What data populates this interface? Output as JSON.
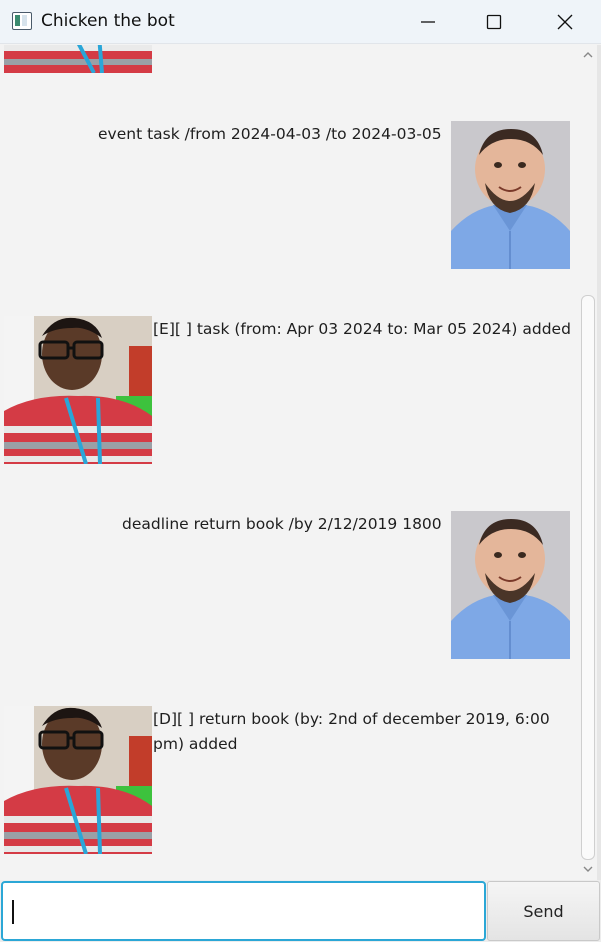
{
  "window": {
    "title": "Chicken the bot",
    "controls": [
      "minimize",
      "maximize",
      "close"
    ]
  },
  "messages": [
    {
      "sender": "user",
      "text": "event task /from 2024-04-03 /to 2024-03-05",
      "avatar": "user-avatar"
    },
    {
      "sender": "bot",
      "text": "[E][ ] task (from: Apr 03 2024 to: Mar 05 2024) added",
      "avatar": "bot-avatar"
    },
    {
      "sender": "user",
      "text": "deadline return book /by 2/12/2019 1800",
      "avatar": "user-avatar"
    },
    {
      "sender": "bot",
      "text_line1": "[D][ ] return book (by: 2nd of december 2019, 6:00",
      "text_line2": "pm) added",
      "avatar": "bot-avatar"
    }
  ],
  "input": {
    "value": "",
    "placeholder": ""
  },
  "send_button": {
    "label": "Send"
  },
  "colors": {
    "input_focus": "#2ba7d6",
    "background": "#f3f3f3",
    "user_shirt": "#7ea8e6",
    "bot_shirt_red": "#d43b45"
  }
}
